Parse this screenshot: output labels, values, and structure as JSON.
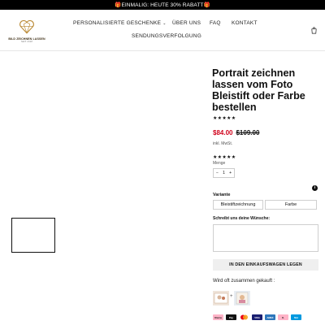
{
  "announcement": "🎁EINMALIG: HEUTE 30% RABATT🎁",
  "brand": {
    "name": "BILD ZEICHNEN LASSEN",
    "sub": "SEIT 2018",
    "color": "#b8862e"
  },
  "nav": {
    "items": [
      {
        "label": "PERSONALISIERTE GESCHENKE",
        "has_dropdown": true
      },
      {
        "label": "ÜBER UNS"
      },
      {
        "label": "FAQ"
      },
      {
        "label": "KONTAKT"
      },
      {
        "label": "SENDUNGSVERFOLGUNG"
      }
    ]
  },
  "product": {
    "title": "Portrait zeichnen lassen vom Foto Bleistift oder Farbe bestellen",
    "rating_stars": "★★★★★",
    "rating_value": 5,
    "price": "$84.00",
    "compare_price": "$109.00",
    "tax_note": "inkl. MwSt.",
    "rating_stars_2": "★★★★★",
    "quantity_label": "Menge",
    "quantity": "1",
    "qty_minus": "−",
    "qty_plus": "+",
    "variant_label": "Variante",
    "variants": [
      "Bleistiftzeichnung",
      "Farbe"
    ],
    "wishes_label": "Schreibt uns deine Wünsche:",
    "wishes_value": "",
    "add_to_cart": "IN DEN EINKAUFSWAGEN LEGEN",
    "frequently_bought": "Wird oft zusammen gekauft :",
    "fbt_plus": "+",
    "info_glyph": "i"
  },
  "payment_methods": [
    {
      "name": "Klarna",
      "color": "#ffb3c7",
      "text": "Klarna"
    },
    {
      "name": "Apple Pay",
      "color": "#111111",
      "text": "Pay"
    },
    {
      "name": "Mastercard",
      "color": "#eb001b",
      "text": "MC"
    },
    {
      "name": "Visa",
      "color": "#1a1f71",
      "text": "VISA"
    },
    {
      "name": "Amex",
      "color": "#2e77bc",
      "text": "AMEX"
    },
    {
      "name": "Klarna 2",
      "color": "#ffb3c7",
      "text": "K."
    },
    {
      "name": "Maestro",
      "color": "#0099df",
      "text": "Mst"
    }
  ],
  "colors": {
    "sale_red": "#d0021b",
    "topbar": "#000000",
    "button_bg": "#efefef"
  }
}
